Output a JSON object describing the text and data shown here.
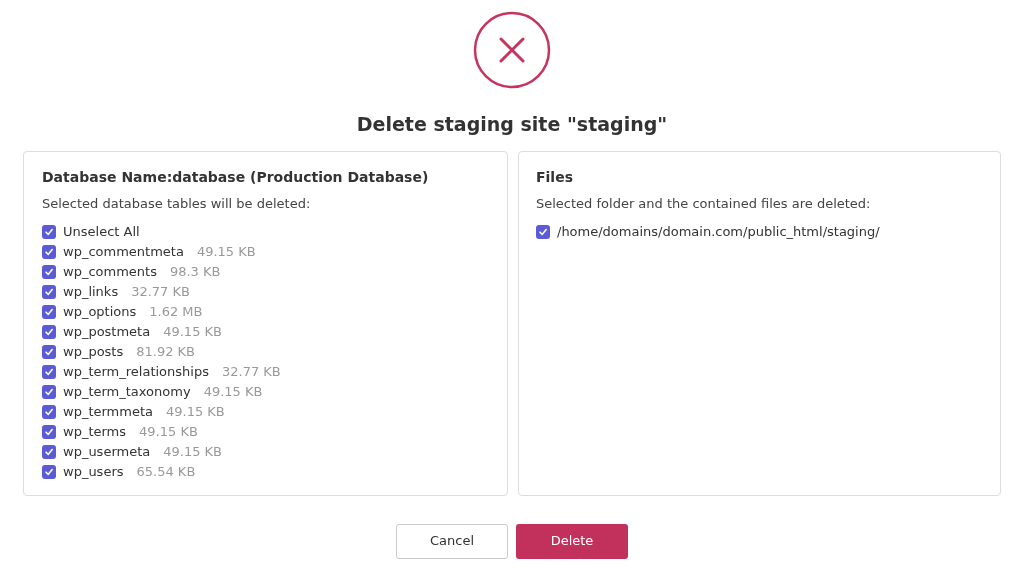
{
  "title": "Delete staging site \"staging\"",
  "database": {
    "heading": "Database Name:database (Production Database)",
    "note": "Selected database tables will be deleted:",
    "select_all": {
      "label": "Unselect All",
      "checked": true
    },
    "tables": [
      {
        "name": "wp_commentmeta",
        "size": "49.15 KB",
        "checked": true
      },
      {
        "name": "wp_comments",
        "size": "98.3 KB",
        "checked": true
      },
      {
        "name": "wp_links",
        "size": "32.77 KB",
        "checked": true
      },
      {
        "name": "wp_options",
        "size": "1.62 MB",
        "checked": true
      },
      {
        "name": "wp_postmeta",
        "size": "49.15 KB",
        "checked": true
      },
      {
        "name": "wp_posts",
        "size": "81.92 KB",
        "checked": true
      },
      {
        "name": "wp_term_relationships",
        "size": "32.77 KB",
        "checked": true
      },
      {
        "name": "wp_term_taxonomy",
        "size": "49.15 KB",
        "checked": true
      },
      {
        "name": "wp_termmeta",
        "size": "49.15 KB",
        "checked": true
      },
      {
        "name": "wp_terms",
        "size": "49.15 KB",
        "checked": true
      },
      {
        "name": "wp_usermeta",
        "size": "49.15 KB",
        "checked": true
      },
      {
        "name": "wp_users",
        "size": "65.54 KB",
        "checked": true
      }
    ]
  },
  "files": {
    "heading": "Files",
    "note": "Selected folder and the contained files are deleted:",
    "folders": [
      {
        "path": "/home/domains/domain.com/public_html/staging/",
        "checked": true
      }
    ]
  },
  "buttons": {
    "cancel": "Cancel",
    "delete": "Delete"
  }
}
